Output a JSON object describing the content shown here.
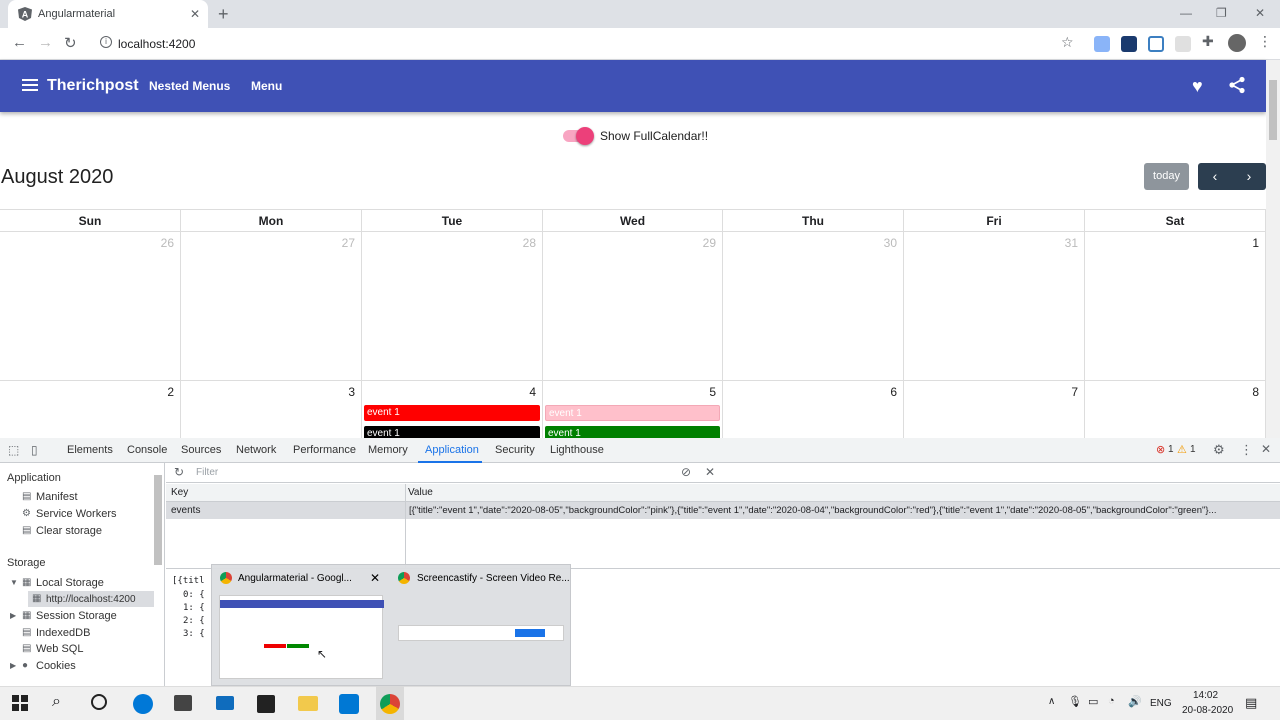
{
  "browser": {
    "tab_title": "Angularmaterial",
    "url": "localhost:4200"
  },
  "app": {
    "brand": "Therichpost",
    "nav": [
      "Nested Menus",
      "Menu"
    ],
    "toggle_label": "Show FullCalendar!!",
    "toggle_on": true,
    "accent": "#3f51b5"
  },
  "calendar": {
    "title": "August 2020",
    "today_label": "today",
    "prev_label": "‹",
    "next_label": "›",
    "weekdays": [
      "Sun",
      "Mon",
      "Tue",
      "Wed",
      "Thu",
      "Fri",
      "Sat"
    ],
    "week1": [
      "26",
      "27",
      "28",
      "29",
      "30",
      "31",
      "1"
    ],
    "week2": [
      "2",
      "3",
      "4",
      "5",
      "6",
      "7",
      "8"
    ],
    "events": [
      {
        "title": "event 1",
        "day": "4",
        "color": "#ff0000"
      },
      {
        "title": "event 1",
        "day": "4",
        "color": "#000000"
      },
      {
        "title": "event 1",
        "day": "5",
        "color": "#ffc0cb"
      },
      {
        "title": "event 1",
        "day": "5",
        "color": "#008000"
      }
    ]
  },
  "devtools": {
    "tabs": [
      "Elements",
      "Console",
      "Sources",
      "Network",
      "Performance",
      "Memory",
      "Application",
      "Security",
      "Lighthouse"
    ],
    "active_tab": "Application",
    "errors": "1",
    "warnings": "1",
    "filter_placeholder": "Filter",
    "sidebar": {
      "application_header": "Application",
      "application_items": [
        "Manifest",
        "Service Workers",
        "Clear storage"
      ],
      "storage_header": "Storage",
      "local_storage": "Local Storage",
      "local_storage_child": "http://localhost:4200",
      "storage_items": [
        "Session Storage",
        "IndexedDB",
        "Web SQL",
        "Cookies"
      ]
    },
    "table": {
      "col_key": "Key",
      "col_value": "Value",
      "row_key": "events",
      "row_value": "[{\"title\":\"event 1\",\"date\":\"2020-08-05\",\"backgroundColor\":\"pink\"},{\"title\":\"event 1\",\"date\":\"2020-08-04\",\"backgroundColor\":\"red\"},{\"title\":\"event 1\",\"date\":\"2020-08-05\",\"backgroundColor\":\"green\"}..."
    },
    "tree": [
      "[{titl",
      "0: {",
      "1: {",
      "2: {",
      "3: {"
    ]
  },
  "taskbar_popup": {
    "items": [
      "Angularmaterial - Googl...",
      "Screencastify - Screen Video Re..."
    ]
  },
  "taskbar": {
    "lang": "ENG",
    "time": "14:02",
    "date": "20-08-2020"
  }
}
